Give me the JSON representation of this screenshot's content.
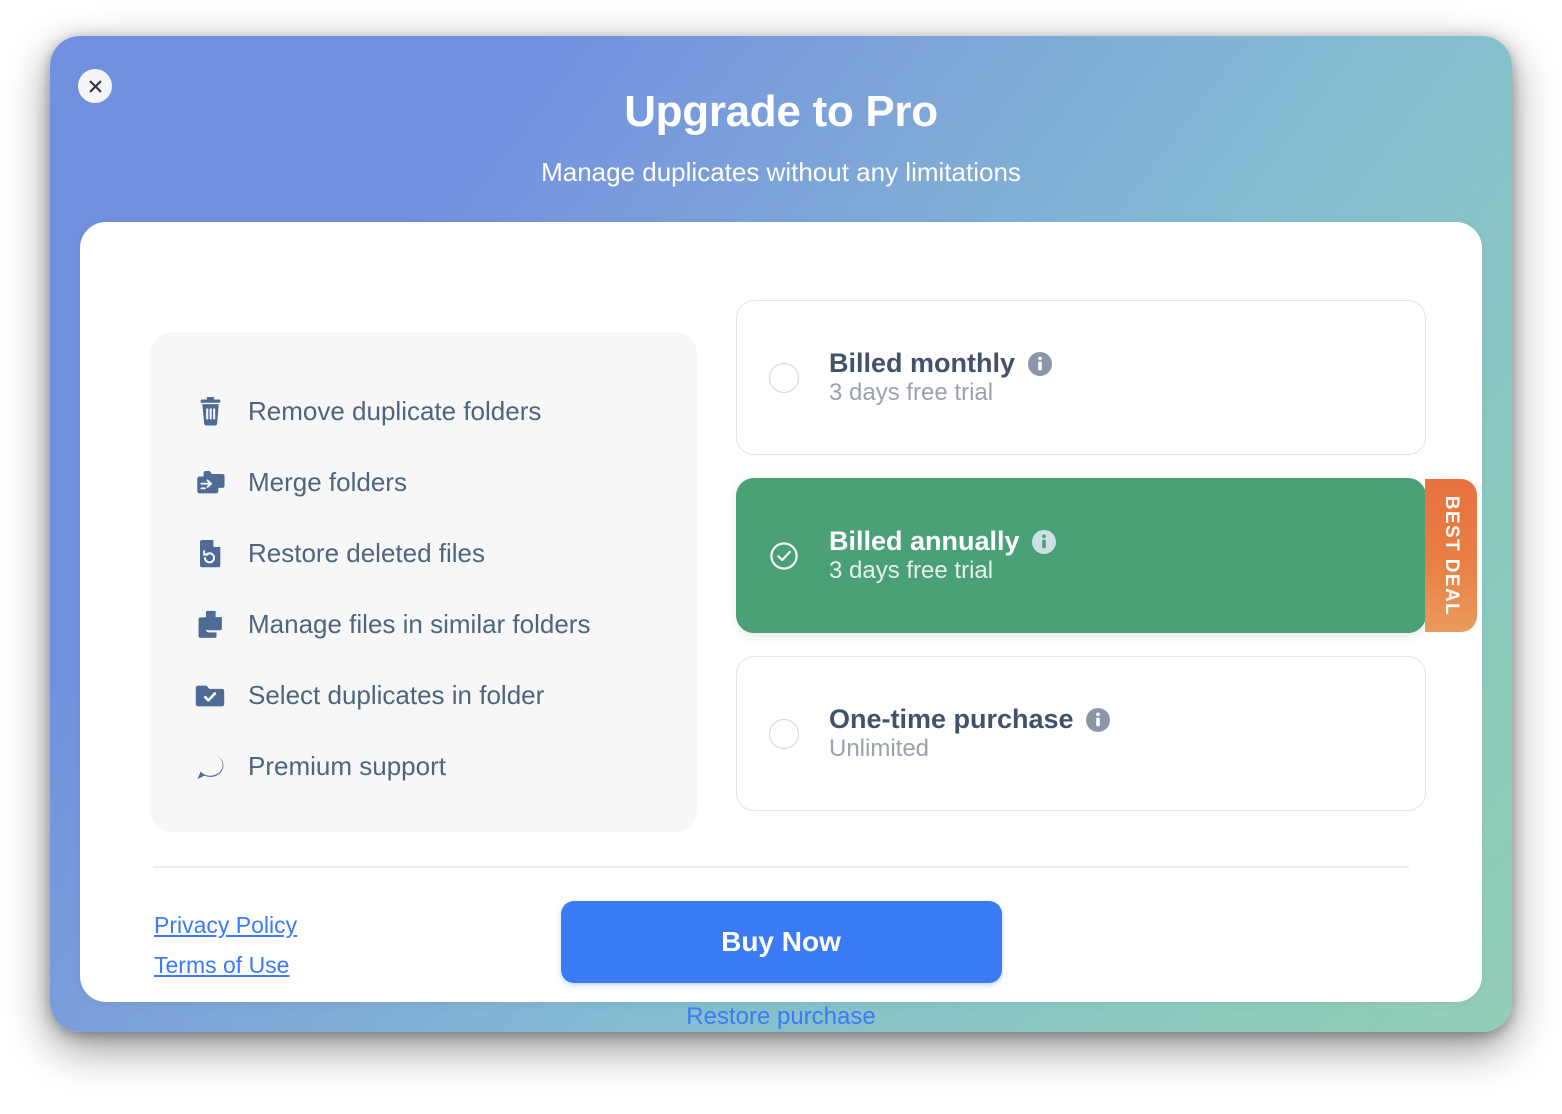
{
  "window": {
    "title": "Upgrade to Pro",
    "subtitle": "Manage duplicates without any limitations",
    "close_icon": "close-icon",
    "gradient_from": "#7290e0",
    "gradient_to": "#93cfb6"
  },
  "features": {
    "items": [
      {
        "icon": "trash-icon",
        "label": "Remove duplicate folders"
      },
      {
        "icon": "merge-folders-icon",
        "label": "Merge folders"
      },
      {
        "icon": "restore-file-icon",
        "label": "Restore deleted files"
      },
      {
        "icon": "copy-files-icon",
        "label": "Manage files in similar folders"
      },
      {
        "icon": "folder-check-icon",
        "label": "Select duplicates in folder"
      },
      {
        "icon": "support-star-icon",
        "label": "Premium support"
      }
    ]
  },
  "plans": {
    "items": [
      {
        "id": "monthly",
        "title": "Billed monthly",
        "subtitle": "3 days free trial",
        "selected": false,
        "info_icon": "info-icon",
        "badge": ""
      },
      {
        "id": "annually",
        "title": "Billed annually",
        "subtitle": "3 days free trial",
        "selected": true,
        "info_icon": "info-icon",
        "badge": "BEST DEAL"
      },
      {
        "id": "onetime",
        "title": "One-time purchase",
        "subtitle": "Unlimited",
        "selected": false,
        "info_icon": "info-icon",
        "badge": ""
      }
    ],
    "selected_color": "#4aa077",
    "badge_color": "#e8713f"
  },
  "footer": {
    "privacy_policy": "Privacy Policy",
    "terms_of_use": "Terms of Use",
    "buy_button": "Buy Now",
    "restore_link": "Restore purchase",
    "accent_color": "#3b7bf5"
  }
}
